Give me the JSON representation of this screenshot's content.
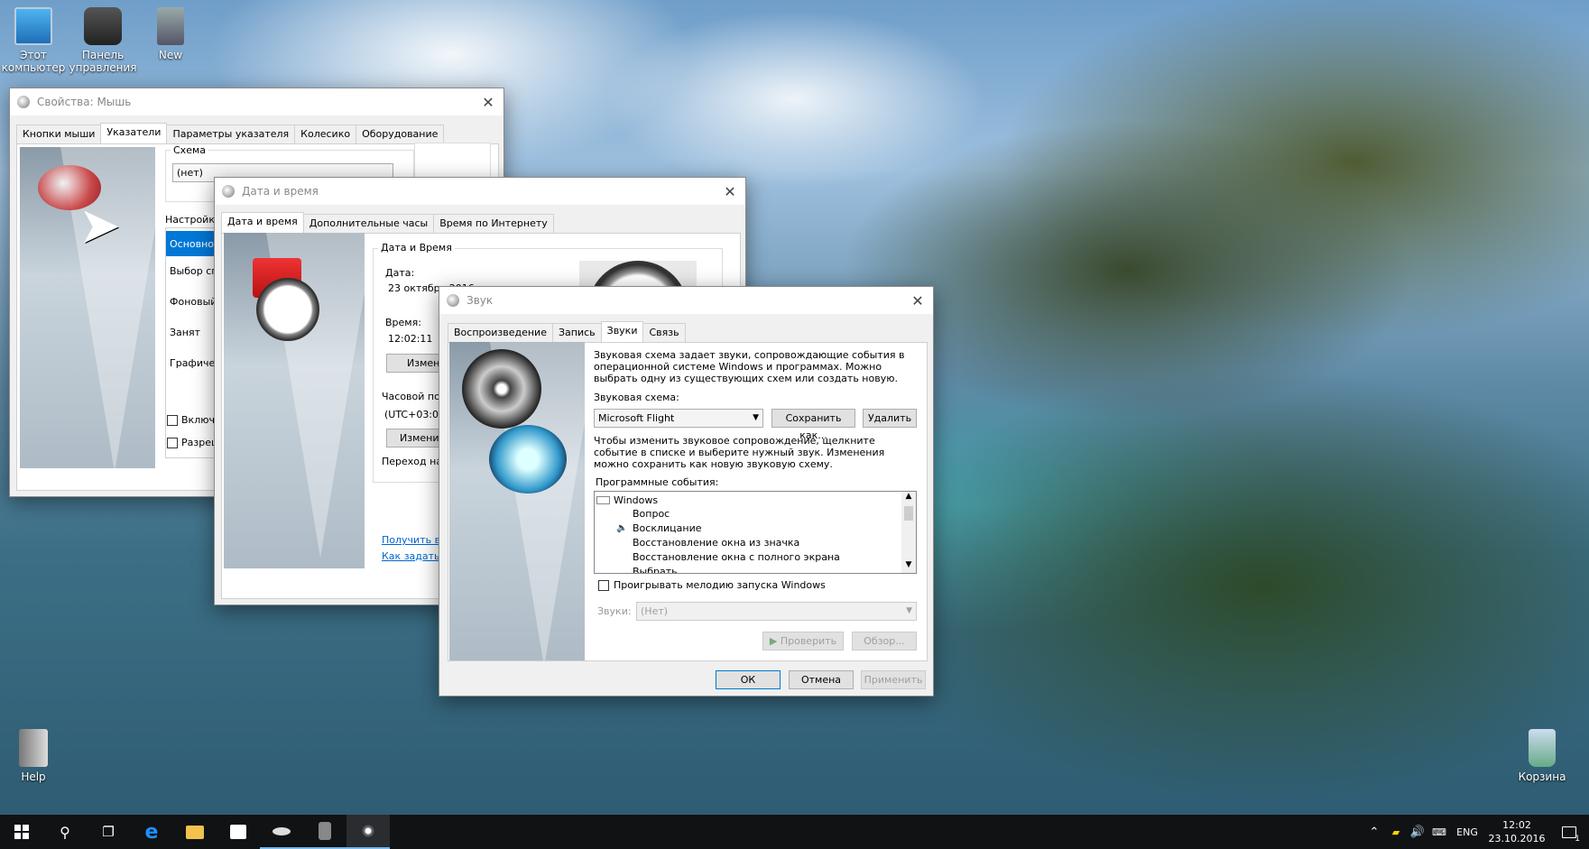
{
  "desktop": {
    "icons": [
      {
        "label_1": "Этот",
        "label_2": "компьютер"
      },
      {
        "label_1": "Панель",
        "label_2": "управления"
      },
      {
        "label_1": "New",
        "label_2": ""
      },
      {
        "label_1": "Help",
        "label_2": ""
      },
      {
        "label_1": "Корзина",
        "label_2": ""
      }
    ]
  },
  "mouse_window": {
    "title": "Свойства: Мышь",
    "tabs": [
      "Кнопки мыши",
      "Указатели",
      "Параметры указателя",
      "Колесико",
      "Оборудование"
    ],
    "scheme_label": "Схема",
    "scheme_value": "(нет)",
    "settings_label": "Настройка",
    "list_items": [
      "Основной",
      "Выбор сп",
      "Фоновый",
      "Занят",
      "Графичес"
    ],
    "checkbox_1": "Включи",
    "checkbox_2": "Разреш"
  },
  "datetime_window": {
    "title": "Дата и время",
    "tabs": [
      "Дата и время",
      "Дополнительные часы",
      "Время по Интернету"
    ],
    "group_title": "Дата и Время",
    "date_label": "Дата:",
    "date_value": "23 октября 2016",
    "time_label": "Время:",
    "time_value": "12:02:11",
    "change_btn": "Измен",
    "tz_label": "Часовой по",
    "tz_value": "(UTC+03:00",
    "tz_btn": "Измени",
    "dst_label": "Переход на",
    "link_1": "Получить в",
    "link_2": "Как задать в"
  },
  "sound_window": {
    "title": "Звук",
    "tabs": [
      "Воспроизведение",
      "Запись",
      "Звуки",
      "Связь"
    ],
    "intro": "Звуковая схема задает звуки, сопровождающие события в операционной системе Windows и программах. Можно выбрать одну из существующих схем или создать новую.",
    "scheme_label": "Звуковая схема:",
    "scheme_value": "Microsoft Flight",
    "save_as": "Сохранить как...",
    "delete": "Удалить",
    "instructions": "Чтобы изменить звуковое сопровождение, щелкните событие в списке и выберите нужный звук. Изменения можно сохранить как новую звуковую схему.",
    "events_label": "Программные события:",
    "events": [
      "Windows",
      "Вопрос",
      "Восклицание",
      "Восстановление окна из значка",
      "Восстановление окна с полного экрана",
      "Выбрать"
    ],
    "startup_checkbox": "Проигрывать мелодию запуска Windows",
    "sounds_label": "Звуки:",
    "sounds_value": "(Нет)",
    "test_btn": "Проверить",
    "browse_btn": "Обзор...",
    "ok": "ОК",
    "cancel": "Отмена",
    "apply": "Применить"
  },
  "taskbar": {
    "lang": "ENG",
    "time": "12:02",
    "date": "23.10.2016",
    "notif_count": "1"
  },
  "colors": {
    "selection": "#0078d7",
    "link": "#0066cc"
  }
}
